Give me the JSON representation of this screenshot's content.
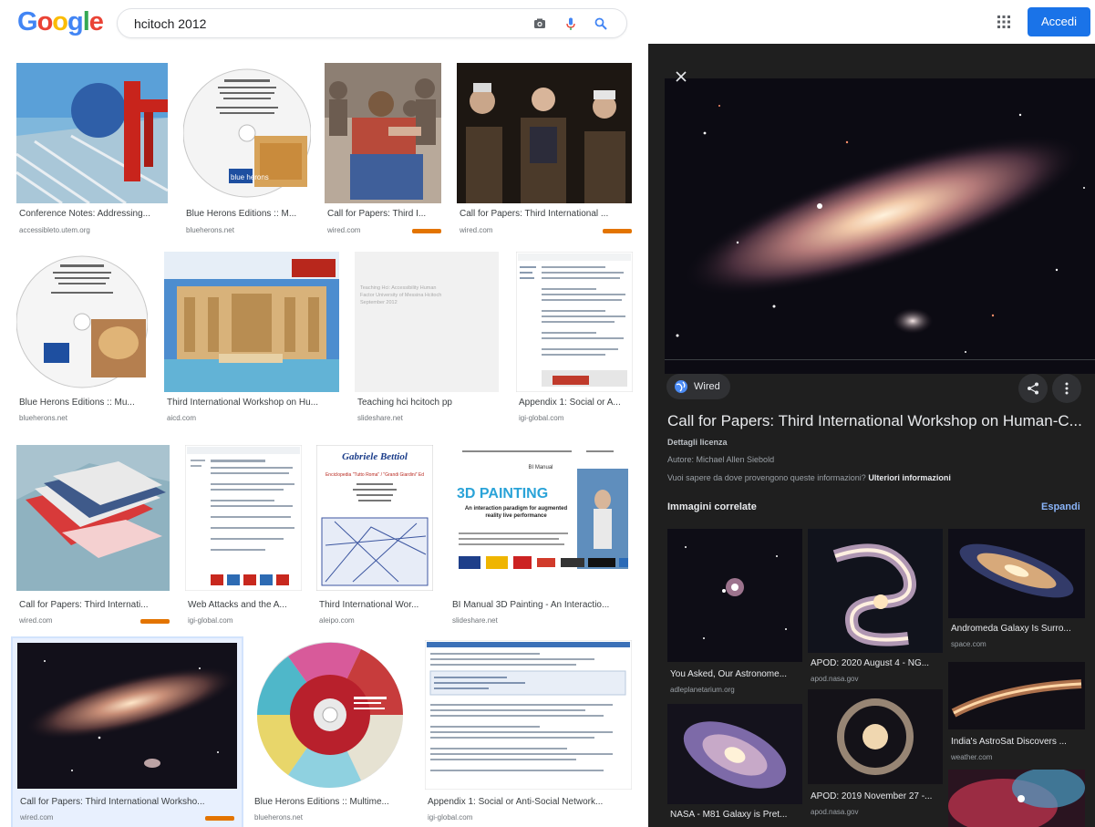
{
  "header": {
    "logo_letters": [
      "G",
      "o",
      "o",
      "g",
      "l",
      "e"
    ],
    "logo_colors": [
      "#4285f4",
      "#ea4335",
      "#fbbc05",
      "#4285f4",
      "#34a853",
      "#ea4335"
    ],
    "query": "hcitoch 2012",
    "signin_label": "Accedi"
  },
  "results": [
    {
      "title": "Conference Notes: Addressing...",
      "source": "accessibleto.utem.org",
      "product": false
    },
    {
      "title": "Blue Herons Editions :: M...",
      "source": "blueherons.net",
      "product": false
    },
    {
      "title": "Call for Papers: Third I...",
      "source": "wired.com",
      "product": true
    },
    {
      "title": "Call for Papers: Third International ...",
      "source": "wired.com",
      "product": true
    },
    {
      "title": "Blue Herons Editions :: Mu...",
      "source": "blueherons.net",
      "product": false
    },
    {
      "title": "Third International Workshop on Hu...",
      "source": "aicd.com",
      "product": false
    },
    {
      "title": "Teaching hci hcitoch pp",
      "source": "slideshare.net",
      "product": false
    },
    {
      "title": "Appendix 1: Social or A...",
      "source": "igi-global.com",
      "product": false
    },
    {
      "title": "Call for Papers: Third Internati...",
      "source": "wired.com",
      "product": true
    },
    {
      "title": "Web Attacks and the A...",
      "source": "igi-global.com",
      "product": false
    },
    {
      "title": "Third International Wor...",
      "source": "aleipo.com",
      "product": false
    },
    {
      "title": "BI Manual 3D Painting - An Interactio...",
      "source": "slideshare.net",
      "product": false
    },
    {
      "title": "Call for Papers: Third International Worksho...",
      "source": "wired.com",
      "product": true
    },
    {
      "title": "Blue Herons Editions :: Multime...",
      "source": "blueherons.net",
      "product": false
    },
    {
      "title": "Appendix 1: Social or Anti-Social Network...",
      "source": "igi-global.com",
      "product": false
    }
  ],
  "thumb_text": {
    "teaching": "Teaching Hci: Accessibility Human Factor University of Messina Hcitoch September 2012",
    "gabriele_name": "Gabriele Bettiol",
    "gabriele_sub": "Enciclopedia \"Tutto Roma\" / \"Grandi Giardini\" Ed",
    "painting_word": "3D PAINTING",
    "painting_caption": "An interaction paradigm for augmented reality live performance",
    "bi_label": "BI Manual",
    "disc_label": "blue herons"
  },
  "panel": {
    "source_name": "Wired",
    "title": "Call for Papers: Third International Workshop on Human-C...",
    "details": "Dettagli licenza",
    "author": "Autore: Michael Allen Siebold",
    "question": "Vuoi sapere da dove provengono queste informazioni?",
    "question_link": "Ulteriori informazioni",
    "related_heading": "Immagini correlate",
    "expand_label": "Espandi",
    "related": [
      {
        "title": "You Asked, Our Astronome...",
        "source": "adleplanetarium.org"
      },
      {
        "title": "APOD: 2020 August 4 - NG...",
        "source": "apod.nasa.gov"
      },
      {
        "title": "Andromeda Galaxy Is Surro...",
        "source": "space.com"
      },
      {
        "title": "NASA - M81 Galaxy is Pret...",
        "source": ""
      },
      {
        "title": "APOD: 2019 November 27 -...",
        "source": "apod.nasa.gov"
      },
      {
        "title": "India's AstroSat Discovers ...",
        "source": "weather.com"
      }
    ]
  }
}
